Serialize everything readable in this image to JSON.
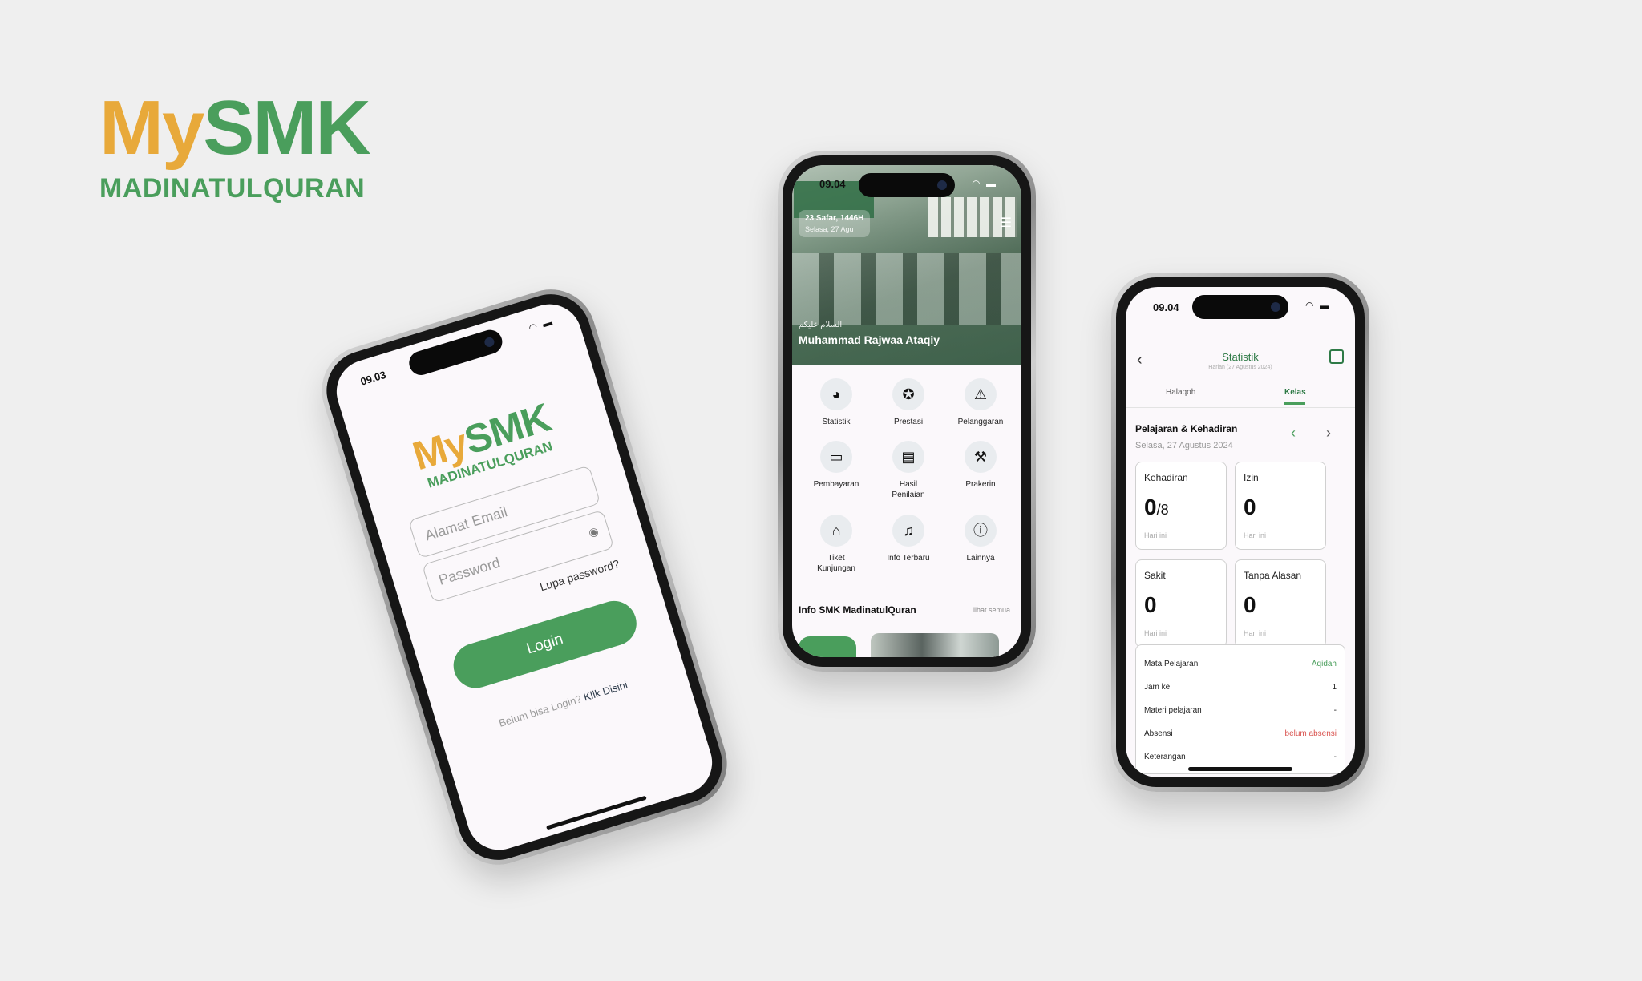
{
  "brand": {
    "my": "My",
    "smk": "SMK",
    "sub": "MADINATULQURAN"
  },
  "colors": {
    "green": "#4a9e5c",
    "gold": "#e8a93a",
    "red": "#d9534f"
  },
  "login": {
    "time": "09.03",
    "logo_my": "My",
    "logo_smk": "SMK",
    "logo_sub": "MADINATULQURAN",
    "email_placeholder": "Alamat Email",
    "password_placeholder": "Password",
    "forgot": "Lupa password?",
    "login_button": "Login",
    "signup_prefix": "Belum bisa Login?",
    "signup_link": "Klik Disini"
  },
  "home": {
    "time": "09.04",
    "hijri_date": "23 Safar, 1446H",
    "date": "Selasa, 27 Agu",
    "greeting": "السلام عليكم",
    "user_name": "Muhammad Rajwaa Ataqiy",
    "menu": [
      {
        "label": "Statistik",
        "icon": "pie-chart-icon"
      },
      {
        "label": "Prestasi",
        "icon": "award-icon"
      },
      {
        "label": "Pelanggaran",
        "icon": "warning-icon"
      },
      {
        "label": "Pembayaran",
        "icon": "card-icon"
      },
      {
        "label": "Hasil Penilaian",
        "icon": "document-icon"
      },
      {
        "label": "Prakerin",
        "icon": "worker-icon"
      },
      {
        "label": "Tiket Kunjungan",
        "icon": "building-icon"
      },
      {
        "label": "Info Terbaru",
        "icon": "bell-icon"
      },
      {
        "label": "Lainnya",
        "icon": "info-icon"
      }
    ],
    "info_title": "Info SMK MadinatulQuran",
    "see_all": "lihat semua"
  },
  "stats": {
    "time": "09.04",
    "title": "Statistik",
    "subtitle": "Harian (27 Agustus 2024)",
    "tabs": [
      "Halaqoh",
      "Kelas"
    ],
    "active_tab": "Kelas",
    "section_title": "Pelajaran & Kehadiran",
    "section_date": "Selasa, 27 Agustus 2024",
    "tiles": [
      {
        "label": "Kehadiran",
        "value": "0",
        "total": "8",
        "footer": "Hari ini"
      },
      {
        "label": "Izin",
        "value": "0",
        "footer": "Hari ini"
      },
      {
        "label": "Sakit",
        "value": "0",
        "footer": "Hari ini"
      },
      {
        "label": "Tanpa Alasan",
        "value": "0",
        "footer": "Hari ini"
      }
    ],
    "details": [
      {
        "label": "Mata Pelajaran",
        "value": "Aqidah"
      },
      {
        "label": "Jam ke",
        "value": "1"
      },
      {
        "label": "Materi pelajaran",
        "value": "-"
      },
      {
        "label": "Absensi",
        "value": "belum absensi"
      },
      {
        "label": "Keterangan",
        "value": "-"
      }
    ]
  }
}
